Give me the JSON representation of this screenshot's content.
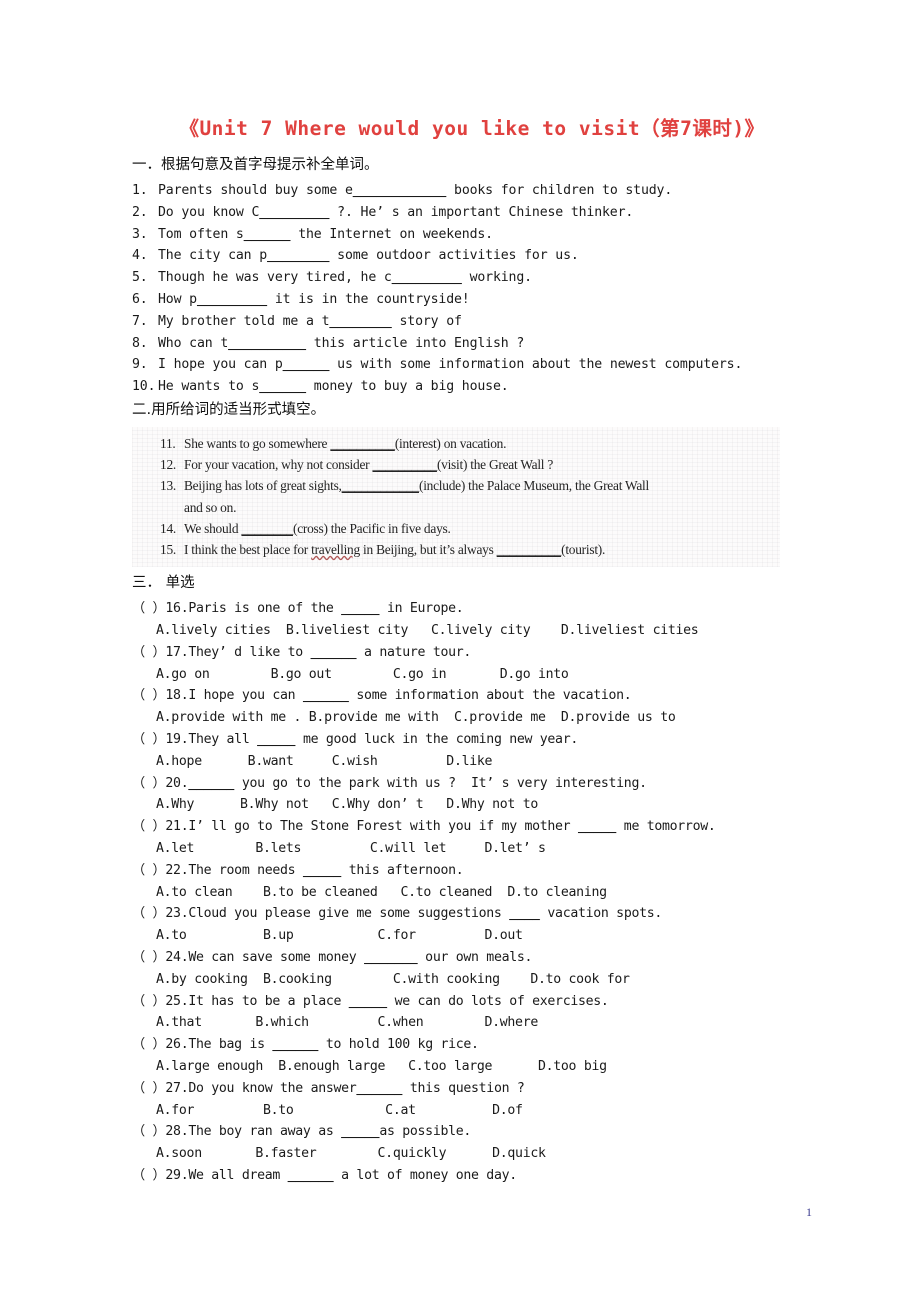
{
  "document": {
    "title": "《Unit 7 Where would you like to visit（第7课时)》",
    "title_color": "#e0413f",
    "page_number": "1",
    "page_number_color": "#3b3b8f"
  },
  "section_one": {
    "heading": "一．根据句意及首字母提示补全单词。",
    "items": [
      {
        "num": "1.",
        "pre": "Parents should buy some e",
        "blank": "____________",
        "post": " books for children to study."
      },
      {
        "num": "2.",
        "pre": "Do you know C",
        "blank": "_________",
        "post": " ?. He’ s an important Chinese thinker."
      },
      {
        "num": "3.",
        "pre": "Tom often s",
        "blank": "______",
        "post": " the Internet on weekends."
      },
      {
        "num": "4.",
        "pre": "The city can p",
        "blank": "________",
        "post": " some outdoor activities for us."
      },
      {
        "num": "5.",
        "pre": "Though he was very tired, he c",
        "blank": "_________",
        "post": " working."
      },
      {
        "num": "6.",
        "pre": "How p",
        "blank": "_________",
        "post": " it is in the countryside!"
      },
      {
        "num": "7.",
        "pre": "My brother told me a t",
        "blank": "________",
        "post": " story of"
      },
      {
        "num": "8.",
        "pre": "Who can t",
        "blank": "__________",
        "post": " this article into English ?"
      },
      {
        "num": "9.",
        "pre": "I hope you can p",
        "blank": "______",
        "post": " us with some information about the newest computers."
      },
      {
        "num": "10.",
        "pre": "He wants to s",
        "blank": "______",
        "post": " money to buy a big house."
      }
    ]
  },
  "section_two": {
    "heading": "二.用所给词的适当形式填空。",
    "items": [
      {
        "num": "11.",
        "pre": "She wants to go somewhere ",
        "blank": "__________",
        "post": "(interest) on vacation."
      },
      {
        "num": "12.",
        "pre": "For your vacation, why not consider ",
        "blank": "__________",
        "post": "(visit) the Great Wall ?"
      },
      {
        "num": "13.",
        "pre": "Beijing has lots of great sights,",
        "blank": "____________",
        "post": "(include) the Palace Museum, the Great Wall"
      },
      {
        "num": "",
        "pre": "and so on.",
        "blank": "",
        "post": "",
        "continuation": true
      },
      {
        "num": "14.",
        "pre": "We should ",
        "blank": "________",
        "post": "(cross) the Pacific in five days."
      },
      {
        "num": "15.",
        "pre": "I think the best place for travelling in Beijing, but it’s always ",
        "blank": "__________",
        "post": "(tourist)."
      }
    ]
  },
  "section_three": {
    "heading": "三． 单选",
    "items": [
      {
        "mark": "（ ）",
        "num": "16.",
        "stem_pre": "Paris is one of the ",
        "stem_blank": "_____",
        "stem_post": " in Europe.",
        "options": "A.lively cities  B.liveliest city   C.lively city    D.liveliest cities"
      },
      {
        "mark": "（ ）",
        "num": "17.",
        "stem_pre": "They’ d like to ",
        "stem_blank": "______",
        "stem_post": " a nature tour.",
        "options": "A.go on        B.go out        C.go in       D.go into"
      },
      {
        "mark": "（ ）",
        "num": "18.",
        "stem_pre": "I hope you can ",
        "stem_blank": "______",
        "stem_post": " some information about the vacation.",
        "options": "A.provide with me . B.provide me with  C.provide me  D.provide us to"
      },
      {
        "mark": "（ ）",
        "num": "19.",
        "stem_pre": "They all ",
        "stem_blank": "_____",
        "stem_post": " me good luck in the coming new year.",
        "options": "A.hope      B.want     C.wish         D.like"
      },
      {
        "mark": "（ ）",
        "num": "20.",
        "stem_pre": "",
        "stem_blank": "______",
        "stem_post": " you go to the park with us ?  It’ s very interesting.",
        "options": "A.Why      B.Why not   C.Why don’ t   D.Why not to"
      },
      {
        "mark": "（ ）",
        "num": "21.",
        "stem_pre": "I’ ll go to The Stone Forest with you if my mother ",
        "stem_blank": "_____",
        "stem_post": " me tomorrow.",
        "options": "A.let        B.lets         C.will let     D.let’ s"
      },
      {
        "mark": "（ ）",
        "num": "22.",
        "stem_pre": "The room needs ",
        "stem_blank": "_____",
        "stem_post": " this afternoon.",
        "options": "A.to clean    B.to be cleaned   C.to cleaned  D.to cleaning"
      },
      {
        "mark": "（ ）",
        "num": "23.",
        "stem_pre": "Cloud you please give me some suggestions ",
        "stem_blank": "____",
        "stem_post": " vacation spots.",
        "options": "A.to          B.up           C.for         D.out"
      },
      {
        "mark": "（ ）",
        "num": "24.",
        "stem_pre": "We can save some money ",
        "stem_blank": "_______",
        "stem_post": " our own meals.",
        "options": "A.by cooking  B.cooking        C.with cooking    D.to cook for"
      },
      {
        "mark": "（ ）",
        "num": "25.",
        "stem_pre": "It has to be a place ",
        "stem_blank": "_____",
        "stem_post": " we can do lots of exercises.",
        "options": "A.that       B.which         C.when        D.where"
      },
      {
        "mark": "（ ）",
        "num": "26.",
        "stem_pre": "The bag is ",
        "stem_blank": "______",
        "stem_post": " to hold 100 kg rice.",
        "options": "A.large enough  B.enough large   C.too large      D.too big"
      },
      {
        "mark": "（ ）",
        "num": "27.",
        "stem_pre": "Do you know the answer",
        "stem_blank": "______",
        "stem_post": " this question ?",
        "options": "A.for         B.to            C.at          D.of"
      },
      {
        "mark": "（ ）",
        "num": "28.",
        "stem_pre": "The boy ran away as ",
        "stem_blank": "_____",
        "stem_post": "as possible.",
        "options": "A.soon       B.faster        C.quickly      D.quick"
      },
      {
        "mark": "（ ）",
        "num": "29.",
        "stem_pre": "We all dream ",
        "stem_blank": "______",
        "stem_post": " a lot of money one day.",
        "options": ""
      }
    ]
  }
}
